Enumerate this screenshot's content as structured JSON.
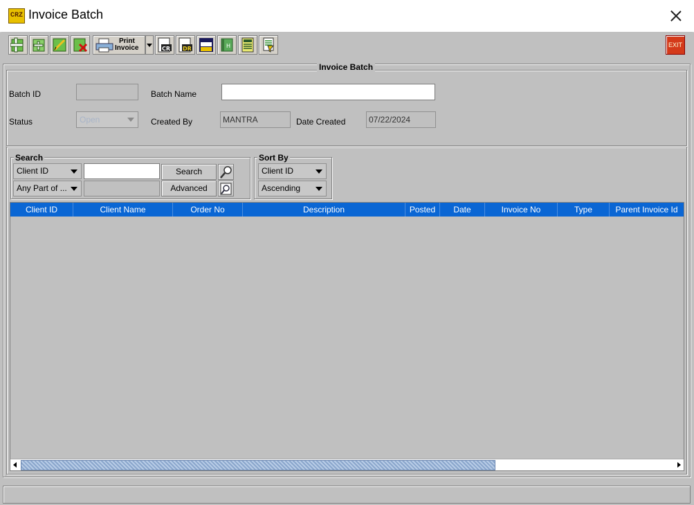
{
  "window": {
    "title": "Invoice Batch",
    "logo_text": "CRZ"
  },
  "toolbar": {
    "print_label_line1": "Print",
    "print_label_line2": "Invoice",
    "exit_label": "EXIT",
    "buttons": [
      "add-icon",
      "add-item-icon",
      "edit-icon",
      "delete-icon",
      "print-icon",
      "credit-memo-icon",
      "debit-memo-icon",
      "invoice-full-credit-icon",
      "history-icon",
      "calculator-icon",
      "filter-icon"
    ]
  },
  "batch_panel": {
    "legend": "Invoice Batch",
    "batch_id_label": "Batch ID",
    "batch_id_value": "",
    "batch_name_label": "Batch Name",
    "batch_name_value": "",
    "status_label": "Status",
    "status_value": "Open",
    "created_by_label": "Created By",
    "created_by_value": "MANTRA",
    "date_created_label": "Date Created",
    "date_created_value": "07/22/2024"
  },
  "search": {
    "legend": "Search",
    "field_selected": "Client ID",
    "match_selected": "Any Part of ...",
    "query_value": "",
    "search_button": "Search",
    "advanced_button": "Advanced"
  },
  "sort": {
    "legend": "Sort By",
    "field_selected": "Client ID",
    "order_selected": "Ascending"
  },
  "table": {
    "columns": [
      "Client ID",
      "Client Name",
      "Order No",
      "Description",
      "Posted",
      "Date",
      "Invoice No",
      "Type",
      "Parent Invoice Id"
    ],
    "rows": []
  },
  "colors": {
    "header_blue": "#0a66d4",
    "background": "#c0c0c0"
  }
}
